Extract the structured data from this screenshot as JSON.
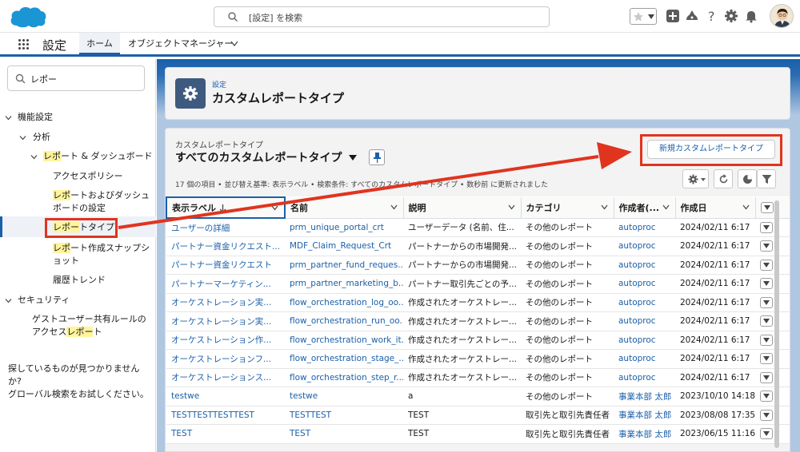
{
  "header": {
    "search_placeholder": "[設定] を検索",
    "brand_color": "#1b96d5"
  },
  "nav": {
    "app_name": "設定",
    "tabs": [
      {
        "label": "ホーム"
      },
      {
        "label": "オブジェクトマネージャー"
      }
    ]
  },
  "sidebar": {
    "search_value": "レポー",
    "items": [
      {
        "label": "機能設定"
      },
      {
        "label": "分析"
      },
      {
        "pre": "",
        "hl": "レポ",
        "post": "ート & ダッシュボード"
      },
      {
        "label": "アクセスポリシー"
      },
      {
        "pre": "",
        "hl": "レポ",
        "post": "ートおよびダッシュボードの設定"
      },
      {
        "pre": "",
        "hl": "レポー",
        "post": "トタイプ"
      },
      {
        "pre": "",
        "hl": "レポ",
        "post": "ート作成スナップショット"
      },
      {
        "label": "履歴トレンド"
      },
      {
        "label": "セキュリティ"
      },
      {
        "pre": "ゲストユーザー共有ルールのアクセス",
        "hl": "レポー",
        "post": "ト"
      }
    ],
    "help_line1": "探しているものが見つかりませんか?",
    "help_line2": "グローバル検索をお試しください。"
  },
  "page_header": {
    "subtitle": "設定",
    "title": "カスタムレポートタイプ"
  },
  "list": {
    "subtitle": "カスタムレポートタイプ",
    "title": "すべてのカスタムレポートタイプ",
    "new_button": "新規カスタムレポートタイプ",
    "info": "17 個の項目 • 並び替え基準: 表示ラベル • 検索条件: すべてのカスタムレポートタイプ • 数秒前 に更新されました",
    "columns": [
      "表示ラベル",
      "名前",
      "説明",
      "カテゴリ",
      "作成者(...",
      "作成日"
    ],
    "rows": [
      [
        "ユーザーの詳細",
        "prm_unique_portal_crt",
        "ユーザーデータ (名前、住...",
        "その他のレポート",
        "autoproc",
        "2024/02/11 6:17"
      ],
      [
        "パートナー資金リクエスト...",
        "MDF_Claim_Request_Crt",
        "パートナーからの市場開発...",
        "その他のレポート",
        "autoproc",
        "2024/02/11 6:17"
      ],
      [
        "パートナー資金リクエスト",
        "prm_partner_fund_reques...",
        "パートナーからの市場開発...",
        "その他のレポート",
        "autoproc",
        "2024/02/11 6:17"
      ],
      [
        "パートナーマーケティン...",
        "prm_partner_marketing_b...",
        "パートナー取引先ごとの予...",
        "その他のレポート",
        "autoproc",
        "2024/02/11 6:17"
      ],
      [
        "オーケストレーション実...",
        "flow_orchestration_log_oo...",
        "作成されたオーケストレー...",
        "その他のレポート",
        "autoproc",
        "2024/02/11 6:17"
      ],
      [
        "オーケストレーション実...",
        "flow_orchestration_run_oo...",
        "作成されたオーケストレー...",
        "その他のレポート",
        "autoproc",
        "2024/02/11 6:17"
      ],
      [
        "オーケストレーション作...",
        "flow_orchestration_work_it...",
        "作成されたオーケストレー...",
        "その他のレポート",
        "autoproc",
        "2024/02/11 6:17"
      ],
      [
        "オーケストレーションフ...",
        "flow_orchestration_stage_...",
        "作成されたオーケストレー...",
        "その他のレポート",
        "autoproc",
        "2024/02/11 6:17"
      ],
      [
        "オーケストレーションス...",
        "flow_orchestration_step_r...",
        "作成されたオーケストレー...",
        "その他のレポート",
        "autoproc",
        "2024/02/11 6:17"
      ],
      [
        "testwe",
        "testwe",
        "a",
        "その他のレポート",
        "事業本部 太郎",
        "2023/10/10 14:18"
      ],
      [
        "TESTTESTTESTTEST",
        "TESTTEST",
        "TEST",
        "取引先と取引先責任者",
        "事業本部 太郎",
        "2023/08/08 17:35"
      ],
      [
        "TEST",
        "TEST",
        "TEST",
        "取引先と取引先責任者",
        "事業本部 太郎",
        "2023/06/15 11:16"
      ]
    ]
  },
  "colors": {
    "accent": "#1b5fa8",
    "annotation": "#e0341f",
    "highlight": "#fff49c"
  }
}
